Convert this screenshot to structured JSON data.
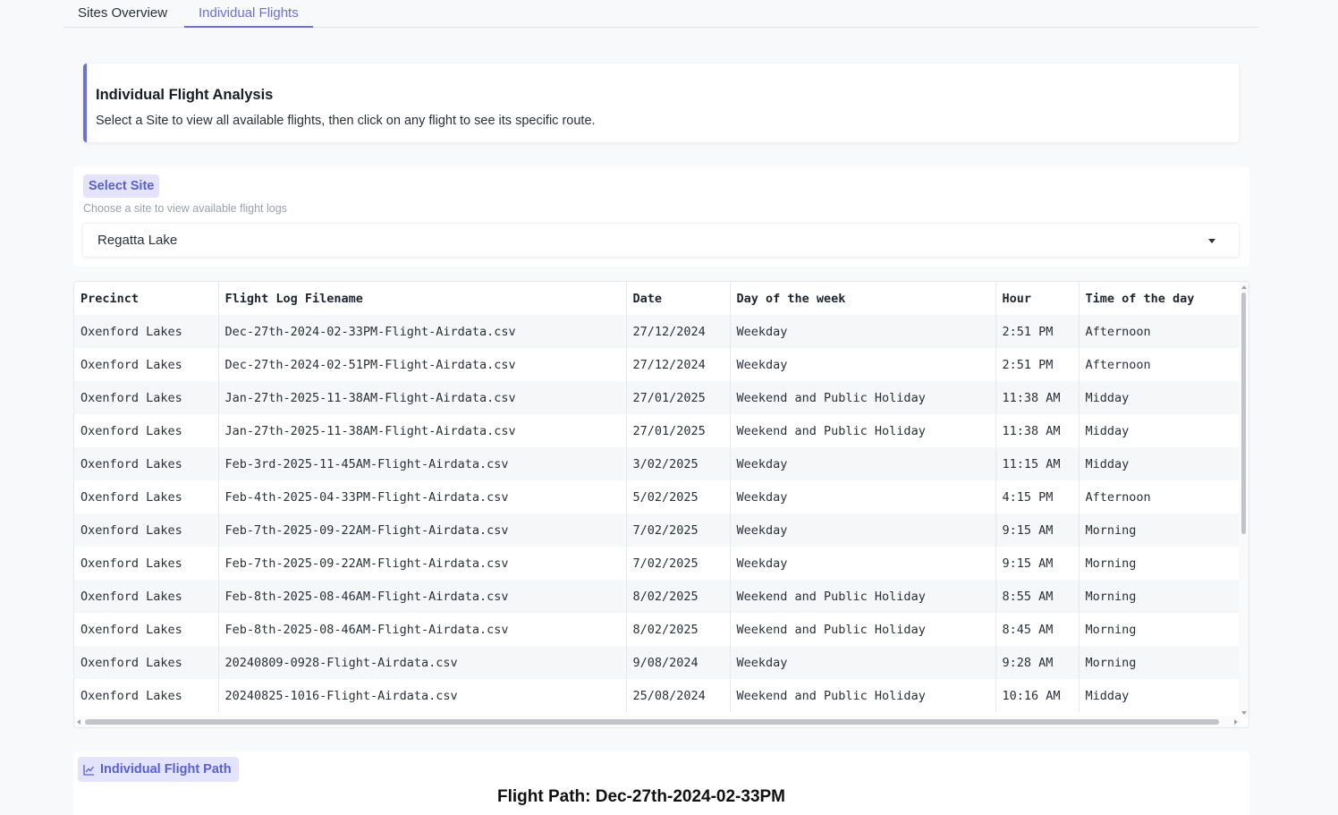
{
  "tabs": [
    {
      "label": "Sites Overview",
      "active": false
    },
    {
      "label": "Individual Flights",
      "active": true
    }
  ],
  "info": {
    "title": "Individual Flight Analysis",
    "text": "Select a Site to view all available flights, then click on any flight to see its specific route."
  },
  "site_select": {
    "label": "Select Site",
    "help": "Choose a site to view available flight logs",
    "value": "Regatta Lake"
  },
  "table": {
    "columns": [
      "Precinct",
      "Flight Log Filename",
      "Date",
      "Day of the week",
      "Hour",
      "Time of the day"
    ],
    "rows": [
      [
        "Oxenford Lakes",
        "Dec-27th-2024-02-33PM-Flight-Airdata.csv",
        "27/12/2024",
        "Weekday",
        "2:51 PM",
        "Afternoon"
      ],
      [
        "Oxenford Lakes",
        "Dec-27th-2024-02-51PM-Flight-Airdata.csv",
        "27/12/2024",
        "Weekday",
        "2:51 PM",
        "Afternoon"
      ],
      [
        "Oxenford Lakes",
        "Jan-27th-2025-11-38AM-Flight-Airdata.csv",
        "27/01/2025",
        "Weekend and Public Holiday",
        "11:38 AM",
        "Midday"
      ],
      [
        "Oxenford Lakes",
        "Jan-27th-2025-11-38AM-Flight-Airdata.csv",
        "27/01/2025",
        "Weekend and Public Holiday",
        "11:38 AM",
        "Midday"
      ],
      [
        "Oxenford Lakes",
        "Feb-3rd-2025-11-45AM-Flight-Airdata.csv",
        "3/02/2025",
        "Weekday",
        "11:15 AM",
        "Midday"
      ],
      [
        "Oxenford Lakes",
        "Feb-4th-2025-04-33PM-Flight-Airdata.csv",
        "5/02/2025",
        "Weekday",
        "4:15 PM",
        "Afternoon"
      ],
      [
        "Oxenford Lakes",
        "Feb-7th-2025-09-22AM-Flight-Airdata.csv",
        "7/02/2025",
        "Weekday",
        "9:15 AM",
        "Morning"
      ],
      [
        "Oxenford Lakes",
        "Feb-7th-2025-09-22AM-Flight-Airdata.csv",
        "7/02/2025",
        "Weekday",
        "9:15 AM",
        "Morning"
      ],
      [
        "Oxenford Lakes",
        "Feb-8th-2025-08-46AM-Flight-Airdata.csv",
        "8/02/2025",
        "Weekend and Public Holiday",
        "8:55 AM",
        "Morning"
      ],
      [
        "Oxenford Lakes",
        "Feb-8th-2025-08-46AM-Flight-Airdata.csv",
        "8/02/2025",
        "Weekend and Public Holiday",
        "8:45 AM",
        "Morning"
      ],
      [
        "Oxenford Lakes",
        "20240809-0928-Flight-Airdata.csv",
        "9/08/2024",
        "Weekday",
        "9:28 AM",
        "Morning"
      ],
      [
        "Oxenford Lakes",
        "20240825-1016-Flight-Airdata.csv",
        "25/08/2024",
        "Weekend and Public Holiday",
        "10:16 AM",
        "Midday"
      ]
    ]
  },
  "flight_path": {
    "label": "Individual Flight Path",
    "icon": "chart-line-icon",
    "title": "Flight Path: Dec-27th-2024-02-33PM"
  },
  "colors": {
    "accent": "#6b6fd6",
    "badge_bg": "#e3e4fb",
    "page_bg": "#f8f9fb"
  }
}
